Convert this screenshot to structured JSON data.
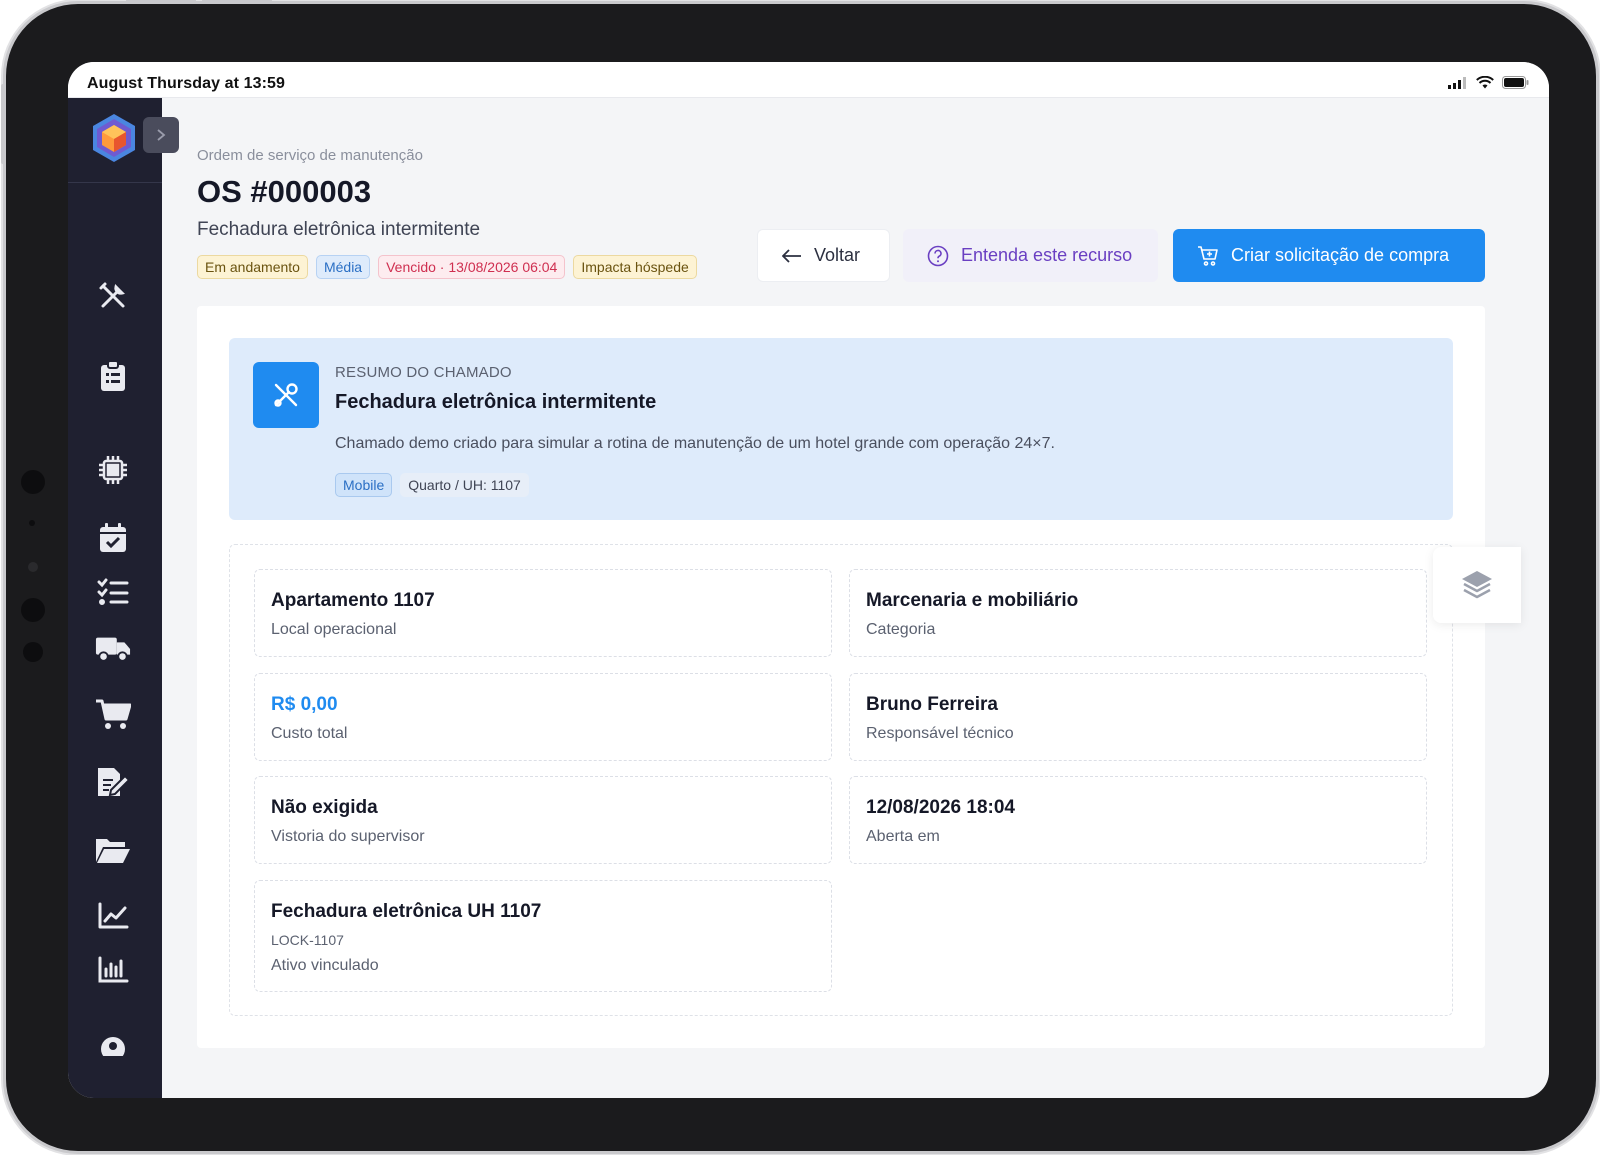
{
  "status_bar": {
    "time": "August Thursday at 13:59"
  },
  "header": {
    "eyebrow": "Ordem de serviço de manutenção",
    "title": "OS #000003",
    "subtitle": "Fechadura eletrônica intermitente",
    "tags": {
      "status": "Em andamento",
      "priority": "Média",
      "due": "Vencido · 13/08/2026 06:04",
      "guest": "Impacta hóspede"
    }
  },
  "actions": {
    "back_label": "Voltar",
    "help_label": "Entenda este recurso",
    "primary_label": "Criar solicitação de compra"
  },
  "summary": {
    "kicker": "RESUMO DO CHAMADO",
    "title": "Fechadura eletrônica intermitente",
    "description": "Chamado demo criado para simular a rotina de manutenção de um hotel grande com operação 24×7.",
    "tag_channel": "Mobile",
    "tag_room": "Quarto / UH: 1107"
  },
  "details": {
    "location": {
      "value": "Apartamento 1107",
      "label": "Local operacional"
    },
    "category": {
      "value": "Marcenaria e mobiliário",
      "label": "Categoria"
    },
    "cost": {
      "value": "R$ 0,00",
      "label": "Custo total"
    },
    "technician": {
      "value": "Bruno Ferreira",
      "label": "Responsável técnico"
    },
    "inspection": {
      "value": "Não exigida",
      "label": "Vistoria do supervisor"
    },
    "opened": {
      "value": "12/08/2026 18:04",
      "label": "Aberta em"
    },
    "asset": {
      "value": "Fechadura eletrônica UH 1107",
      "code": "LOCK-1107",
      "label": "Ativo vinculado"
    }
  },
  "colors": {
    "sidebar": "#1f2030",
    "primary": "#1f8bf0",
    "help": "#6a3fc2",
    "summary_bg": "#deebfb",
    "due": "#cf2f50"
  },
  "icons": {
    "sidebar": [
      "tools-icon",
      "clipboard-icon",
      "chip-icon",
      "calendar-check-icon",
      "checklist-icon",
      "truck-icon",
      "cart-icon",
      "document-edit-icon",
      "folder-open-icon",
      "line-chart-icon",
      "bar-chart-icon",
      "user-icon"
    ]
  }
}
